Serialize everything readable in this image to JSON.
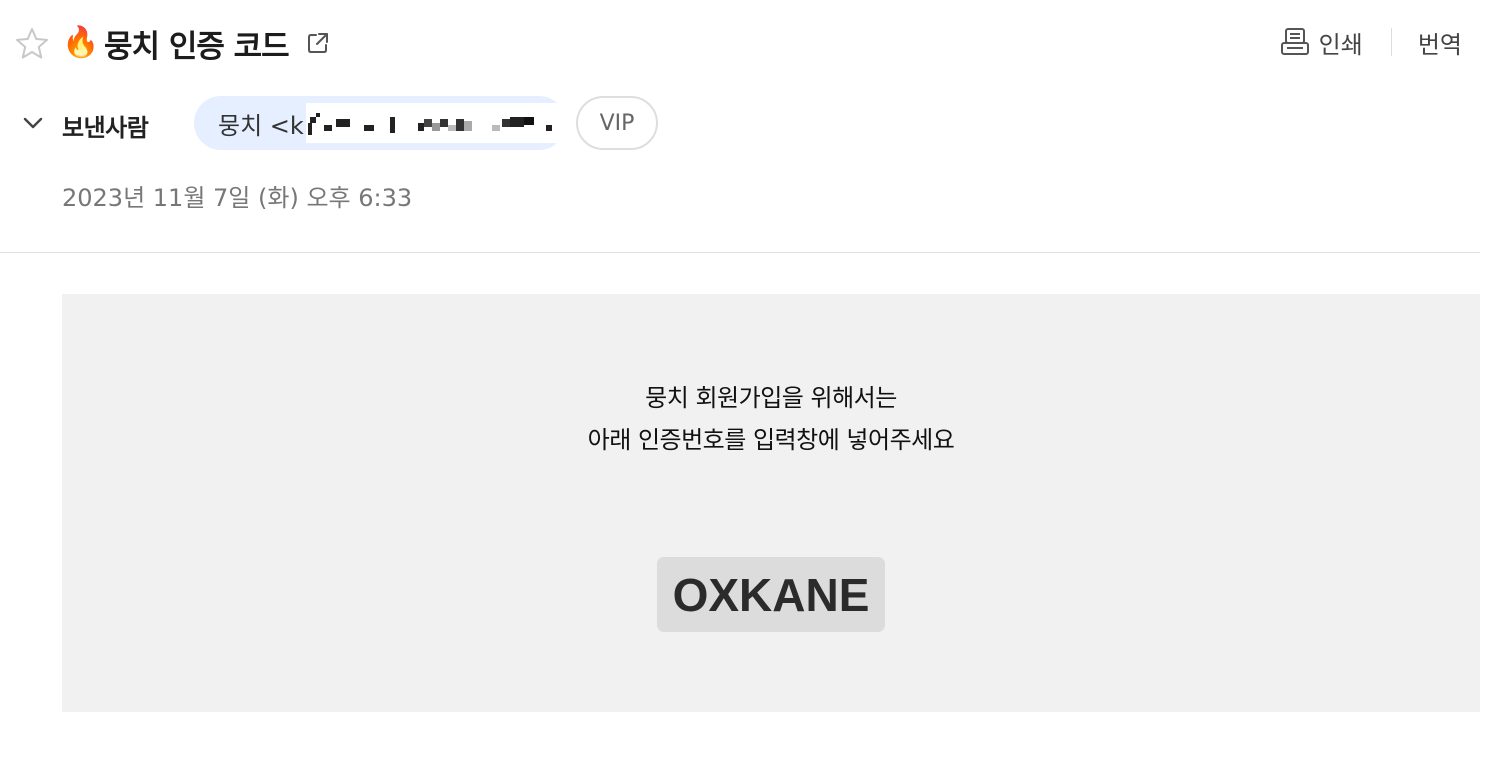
{
  "header": {
    "emoji": "🔥",
    "subject": "뭉치 인증 코드",
    "print_label": "인쇄",
    "translate_label": "번역",
    "icons": [
      "star-icon",
      "external-link-icon",
      "print-icon"
    ]
  },
  "sender": {
    "label": "보낸사람",
    "chip_text": "뭉치 <k",
    "vip_label": "VIP",
    "chip_color": "#e6efff",
    "icons": [
      "chevron-down-icon"
    ]
  },
  "meta": {
    "date": "2023년 11월 7일 (화) 오후 6:33"
  },
  "body": {
    "line1": "뭉치 회원가입을 위해서는",
    "line2": "아래 인증번호를 입력창에 넣어주세요",
    "code": "OXKANE",
    "background_color": "#f1f1f1",
    "code_background": "#dcdcdc"
  }
}
